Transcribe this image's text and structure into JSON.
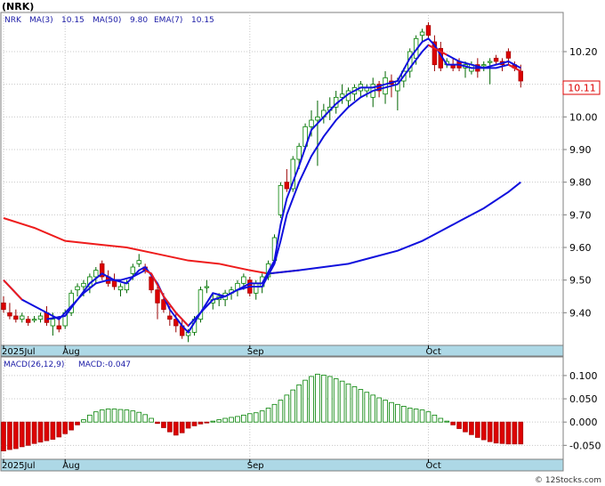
{
  "title": "(NRK)",
  "legend": {
    "ticker": "NRK",
    "ma3_label": "MA(3)",
    "ma3_value": "10.15",
    "ma50_label": "MA(50)",
    "ma50_value": "9.80",
    "ema7_label": "EMA(7)",
    "ema7_value": "10.15"
  },
  "macd_legend": {
    "params": "MACD(26,12,9)",
    "value_label": "MACD:-0.047"
  },
  "last_price_label": "10.11",
  "watermark": "© 12Stocks.com",
  "colors": {
    "up": "#008000",
    "down": "#dd0000",
    "ma_short": "#1010dd",
    "ma_long": "#ee1c1c",
    "date_band": "#add8e6",
    "frame": "#7f7f7f",
    "last_label_bg": "#ffffff",
    "last_label_border": "#dd0000"
  },
  "chart_data": [
    {
      "type": "candlestick",
      "ticker": "NRK",
      "yticks": [
        "9.40",
        "9.50",
        "9.60",
        "9.70",
        "9.80",
        "9.90",
        "10.00",
        "10.10",
        "10.20"
      ],
      "ylim": [
        9.3,
        10.32
      ],
      "xtick_labels": [
        "2025Jul",
        "Aug",
        "Sep",
        "Oct"
      ],
      "xtick_positions": [
        0,
        10,
        40,
        69
      ],
      "n": 85,
      "candles": [
        [
          9.43,
          9.45,
          9.4,
          9.41
        ],
        [
          9.4,
          9.43,
          9.38,
          9.39
        ],
        [
          9.39,
          9.41,
          9.37,
          9.38
        ],
        [
          9.38,
          9.4,
          9.37,
          9.39
        ],
        [
          9.38,
          9.39,
          9.36,
          9.37
        ],
        [
          9.38,
          9.39,
          9.37,
          9.38
        ],
        [
          9.38,
          9.4,
          9.37,
          9.39
        ],
        [
          9.4,
          9.42,
          9.36,
          9.37
        ],
        [
          9.36,
          9.4,
          9.33,
          9.38
        ],
        [
          9.36,
          9.39,
          9.34,
          9.35
        ],
        [
          9.36,
          9.41,
          9.35,
          9.4
        ],
        [
          9.4,
          9.47,
          9.39,
          9.46
        ],
        [
          9.47,
          9.49,
          9.45,
          9.48
        ],
        [
          9.48,
          9.5,
          9.45,
          9.49
        ],
        [
          9.48,
          9.52,
          9.46,
          9.51
        ],
        [
          9.51,
          9.54,
          9.49,
          9.53
        ],
        [
          9.55,
          9.56,
          9.5,
          9.51
        ],
        [
          9.51,
          9.53,
          9.48,
          9.49
        ],
        [
          9.5,
          9.52,
          9.47,
          9.48
        ],
        [
          9.47,
          9.49,
          9.45,
          9.48
        ],
        [
          9.47,
          9.5,
          9.46,
          9.49
        ],
        [
          9.52,
          9.55,
          9.5,
          9.54
        ],
        [
          9.55,
          9.58,
          9.54,
          9.56
        ],
        [
          9.54,
          9.55,
          9.52,
          9.53
        ],
        [
          9.51,
          9.52,
          9.46,
          9.47
        ],
        [
          9.47,
          9.49,
          9.38,
          9.43
        ],
        [
          9.44,
          9.46,
          9.4,
          9.41
        ],
        [
          9.39,
          9.42,
          9.36,
          9.38
        ],
        [
          9.38,
          9.4,
          9.34,
          9.36
        ],
        [
          9.36,
          9.38,
          9.32,
          9.33
        ],
        [
          9.33,
          9.35,
          9.31,
          9.34
        ],
        [
          9.34,
          9.39,
          9.33,
          9.38
        ],
        [
          9.38,
          9.48,
          9.37,
          9.47
        ],
        [
          9.48,
          9.5,
          9.46,
          9.48
        ],
        [
          9.43,
          9.46,
          9.41,
          9.44
        ],
        [
          9.44,
          9.46,
          9.42,
          9.45
        ],
        [
          9.44,
          9.47,
          9.42,
          9.46
        ],
        [
          9.46,
          9.48,
          9.44,
          9.47
        ],
        [
          9.47,
          9.5,
          9.45,
          9.49
        ],
        [
          9.49,
          9.52,
          9.47,
          9.51
        ],
        [
          9.5,
          9.51,
          9.45,
          9.46
        ],
        [
          9.46,
          9.5,
          9.44,
          9.49
        ],
        [
          9.48,
          9.52,
          9.46,
          9.51
        ],
        [
          9.51,
          9.56,
          9.5,
          9.55
        ],
        [
          9.56,
          9.64,
          9.55,
          9.63
        ],
        [
          9.7,
          9.8,
          9.69,
          9.79
        ],
        [
          9.8,
          9.84,
          9.77,
          9.78
        ],
        [
          9.78,
          9.88,
          9.77,
          9.87
        ],
        [
          9.87,
          9.92,
          9.84,
          9.91
        ],
        [
          9.91,
          9.98,
          9.9,
          9.97
        ],
        [
          9.97,
          10.02,
          9.94,
          9.99
        ],
        [
          9.99,
          10.05,
          9.85,
          10.0
        ],
        [
          10.0,
          10.04,
          9.98,
          10.02
        ],
        [
          10.02,
          10.06,
          9.99,
          10.03
        ],
        [
          10.03,
          10.08,
          10.01,
          10.06
        ],
        [
          10.06,
          10.1,
          10.04,
          10.07
        ],
        [
          10.05,
          10.09,
          10.03,
          10.08
        ],
        [
          10.07,
          10.1,
          10.05,
          10.09
        ],
        [
          10.08,
          10.11,
          10.06,
          10.1
        ],
        [
          10.08,
          10.1,
          10.06,
          10.09
        ],
        [
          10.06,
          10.12,
          10.03,
          10.1
        ],
        [
          10.1,
          10.11,
          10.06,
          10.08
        ],
        [
          10.07,
          10.14,
          10.04,
          10.12
        ],
        [
          10.11,
          10.13,
          10.06,
          10.1
        ],
        [
          10.08,
          10.12,
          10.02,
          10.11
        ],
        [
          10.11,
          10.15,
          10.09,
          10.14
        ],
        [
          10.14,
          10.21,
          10.12,
          10.2
        ],
        [
          10.18,
          10.25,
          10.16,
          10.24
        ],
        [
          10.25,
          10.27,
          10.23,
          10.26
        ],
        [
          10.28,
          10.29,
          10.24,
          10.25
        ],
        [
          10.23,
          10.25,
          10.14,
          10.16
        ],
        [
          10.21,
          10.23,
          10.14,
          10.15
        ],
        [
          10.16,
          10.18,
          10.15,
          10.17
        ],
        [
          10.16,
          10.18,
          10.14,
          10.15
        ],
        [
          10.17,
          10.18,
          10.14,
          10.15
        ],
        [
          10.15,
          10.17,
          10.12,
          10.16
        ],
        [
          10.14,
          10.17,
          10.13,
          10.16
        ],
        [
          10.16,
          10.18,
          10.12,
          10.14
        ],
        [
          10.16,
          10.17,
          10.14,
          10.16
        ],
        [
          10.17,
          10.18,
          10.1,
          10.17
        ],
        [
          10.18,
          10.19,
          10.16,
          10.17
        ],
        [
          10.17,
          10.18,
          10.14,
          10.16
        ],
        [
          10.2,
          10.21,
          10.16,
          10.18
        ],
        [
          10.16,
          10.17,
          10.14,
          10.15
        ],
        [
          10.14,
          10.16,
          10.09,
          10.11
        ]
      ],
      "ma3": [
        [
          7,
          9.38
        ],
        [
          10,
          9.39
        ],
        [
          12,
          9.44
        ],
        [
          14,
          9.49
        ],
        [
          16,
          9.52
        ],
        [
          18,
          9.5
        ],
        [
          20,
          9.49
        ],
        [
          22,
          9.53
        ],
        [
          23,
          9.54
        ],
        [
          25,
          9.49
        ],
        [
          27,
          9.41
        ],
        [
          29,
          9.36
        ],
        [
          30,
          9.34
        ],
        [
          32,
          9.4
        ],
        [
          34,
          9.46
        ],
        [
          36,
          9.45
        ],
        [
          38,
          9.47
        ],
        [
          40,
          9.49
        ],
        [
          42,
          9.49
        ],
        [
          44,
          9.56
        ],
        [
          45,
          9.67
        ],
        [
          46,
          9.75
        ],
        [
          48,
          9.85
        ],
        [
          50,
          9.96
        ],
        [
          52,
          10.0
        ],
        [
          54,
          10.04
        ],
        [
          56,
          10.07
        ],
        [
          58,
          10.09
        ],
        [
          60,
          10.09
        ],
        [
          62,
          10.1
        ],
        [
          64,
          10.11
        ],
        [
          66,
          10.18
        ],
        [
          68,
          10.23
        ],
        [
          69,
          10.24
        ],
        [
          70,
          10.22
        ],
        [
          71,
          10.19
        ],
        [
          72,
          10.16
        ],
        [
          74,
          10.16
        ],
        [
          76,
          10.15
        ],
        [
          78,
          10.15
        ],
        [
          80,
          10.16
        ],
        [
          82,
          10.17
        ],
        [
          84,
          10.15
        ]
      ],
      "ema7": [
        [
          0,
          9.5
        ],
        [
          3,
          9.44
        ],
        [
          6,
          9.41
        ],
        [
          9,
          9.38
        ],
        [
          11,
          9.42
        ],
        [
          13,
          9.46
        ],
        [
          15,
          9.49
        ],
        [
          17,
          9.5
        ],
        [
          19,
          9.5
        ],
        [
          21,
          9.51
        ],
        [
          23,
          9.53
        ],
        [
          24,
          9.52
        ],
        [
          26,
          9.45
        ],
        [
          28,
          9.4
        ],
        [
          30,
          9.36
        ],
        [
          32,
          9.4
        ],
        [
          34,
          9.44
        ],
        [
          36,
          9.45
        ],
        [
          38,
          9.47
        ],
        [
          40,
          9.48
        ],
        [
          42,
          9.48
        ],
        [
          44,
          9.55
        ],
        [
          45,
          9.62
        ],
        [
          46,
          9.7
        ],
        [
          48,
          9.8
        ],
        [
          50,
          9.88
        ],
        [
          52,
          9.94
        ],
        [
          54,
          9.99
        ],
        [
          56,
          10.03
        ],
        [
          58,
          10.06
        ],
        [
          60,
          10.08
        ],
        [
          62,
          10.09
        ],
        [
          64,
          10.1
        ],
        [
          66,
          10.15
        ],
        [
          68,
          10.2
        ],
        [
          69,
          10.22
        ],
        [
          70,
          10.21
        ],
        [
          72,
          10.19
        ],
        [
          74,
          10.17
        ],
        [
          76,
          10.16
        ],
        [
          78,
          10.15
        ],
        [
          80,
          10.15
        ],
        [
          82,
          10.16
        ],
        [
          84,
          10.14
        ]
      ],
      "ma50": [
        [
          0,
          9.69
        ],
        [
          5,
          9.66
        ],
        [
          10,
          9.62
        ],
        [
          15,
          9.61
        ],
        [
          20,
          9.6
        ],
        [
          25,
          9.58
        ],
        [
          30,
          9.56
        ],
        [
          35,
          9.55
        ],
        [
          40,
          9.53
        ],
        [
          43,
          9.52
        ],
        [
          48,
          9.53
        ],
        [
          52,
          9.54
        ],
        [
          56,
          9.55
        ],
        [
          60,
          9.57
        ],
        [
          64,
          9.59
        ],
        [
          68,
          9.62
        ],
        [
          70,
          9.64
        ],
        [
          74,
          9.68
        ],
        [
          78,
          9.72
        ],
        [
          82,
          9.77
        ],
        [
          84,
          9.8
        ]
      ],
      "ma50_red_until": 48
    },
    {
      "type": "bar",
      "name": "MACD histogram",
      "yticks": [
        "0.100",
        "0.050",
        "0.000",
        "-0.050"
      ],
      "ylim": [
        -0.08,
        0.14
      ],
      "values": [
        -0.062,
        -0.059,
        -0.057,
        -0.053,
        -0.05,
        -0.046,
        -0.043,
        -0.04,
        -0.037,
        -0.032,
        -0.025,
        -0.017,
        -0.006,
        0.005,
        0.015,
        0.022,
        0.026,
        0.028,
        0.028,
        0.027,
        0.026,
        0.024,
        0.021,
        0.016,
        0.008,
        -0.003,
        -0.012,
        -0.021,
        -0.028,
        -0.023,
        -0.013,
        -0.008,
        -0.004,
        -0.001,
        0.002,
        0.005,
        0.008,
        0.01,
        0.012,
        0.015,
        0.018,
        0.02,
        0.024,
        0.03,
        0.038,
        0.047,
        0.058,
        0.069,
        0.08,
        0.09,
        0.098,
        0.103,
        0.101,
        0.098,
        0.093,
        0.088,
        0.082,
        0.076,
        0.07,
        0.064,
        0.058,
        0.052,
        0.047,
        0.042,
        0.038,
        0.034,
        0.03,
        0.028,
        0.026,
        0.022,
        0.015,
        0.008,
        0.002,
        -0.006,
        -0.014,
        -0.021,
        -0.027,
        -0.033,
        -0.038,
        -0.042,
        -0.045,
        -0.046,
        -0.047,
        -0.047,
        -0.047
      ],
      "xtick_labels": [
        "2025Jul",
        "Aug",
        "Sep",
        "Oct"
      ],
      "xtick_positions": [
        0,
        10,
        40,
        69
      ]
    }
  ]
}
